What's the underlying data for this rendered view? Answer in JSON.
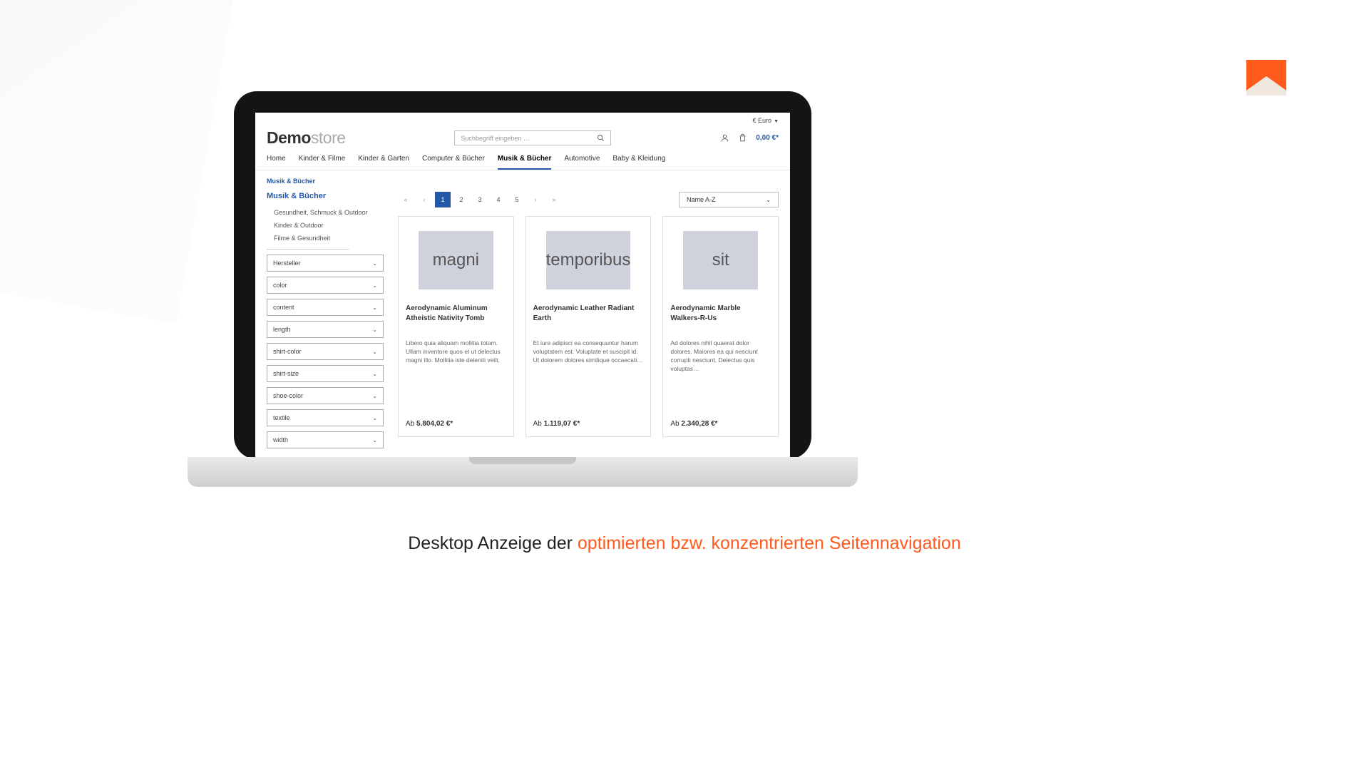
{
  "caption": {
    "prefix": "Desktop Anzeige der ",
    "highlight": "optimierten bzw. konzentrierten Seitennavigation"
  },
  "header": {
    "currency": "€ Euro",
    "logo_bold": "Demo",
    "logo_rest": "store",
    "search_placeholder": "Suchbegriff eingeben …",
    "cart_total": "0,00 €*"
  },
  "nav": {
    "items": [
      "Home",
      "Kinder & Filme",
      "Kinder & Garten",
      "Computer & Bücher",
      "Musik & Bücher",
      "Automotive",
      "Baby & Kleidung"
    ],
    "active_index": 4
  },
  "breadcrumb": "Musik & Bücher",
  "sidebar": {
    "title": "Musik & Bücher",
    "subcats": [
      "Gesundheit, Schmuck & Outdoor",
      "Kinder & Outdoor",
      "Filme & Gesundheit"
    ],
    "filters": [
      "Hersteller",
      "color",
      "content",
      "length",
      "shirt-color",
      "shirt-size",
      "shoe-color",
      "textile",
      "width"
    ]
  },
  "toolbar": {
    "pages": [
      "1",
      "2",
      "3",
      "4",
      "5"
    ],
    "sort_label": "Name A-Z"
  },
  "products": [
    {
      "img_text": "magni",
      "name": "Aerodynamic Aluminum Atheistic Nativity Tomb",
      "desc": "Libero quia aliquam mollitia totam. Ullam inventore quos et ut delectus magni illo. Mollitia iste deleniti velit.",
      "price_prefix": "Ab ",
      "price": "5.804,02 €*"
    },
    {
      "img_text": "temporibus",
      "name": "Aerodynamic Leather Radiant Earth",
      "desc": "Et iure adipisci ea consequuntur harum voluptatem est. Voluptate et suscipit id. Ut dolorem dolores similique occaecati…",
      "price_prefix": "Ab ",
      "price": "1.119,07 €*"
    },
    {
      "img_text": "sit",
      "name": "Aerodynamic Marble Walkers-R-Us",
      "desc": "Ad dolores nihil quaerat dolor dolores. Maiores ea qui nesciunt corrupti nesciunt. Delectus quis voluptas…",
      "price_prefix": "Ab ",
      "price": "2.340,28 €*"
    }
  ]
}
